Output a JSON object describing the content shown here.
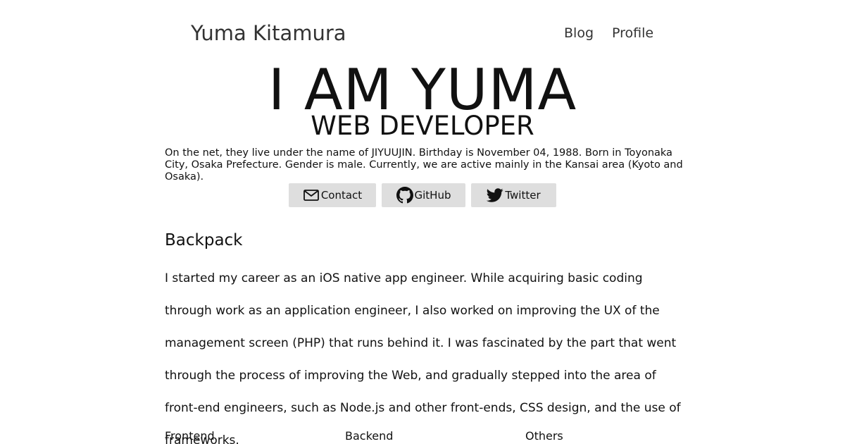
{
  "header": {
    "site_title": "Yuma Kitamura",
    "nav": [
      {
        "label": "Blog"
      },
      {
        "label": "Profile"
      }
    ]
  },
  "hero": {
    "name": "I AM YUMA",
    "role": "WEB DEVELOPER",
    "bio": "On the net, they live under the name of JIYUUJIN. Birthday is November 04, 1988. Born in Toyonaka City, Osaka Prefecture. Gender is male. Currently, we are active mainly in the Kansai area (Kyoto and Osaka)."
  },
  "social": [
    {
      "label": "Contact",
      "icon": "mail-icon"
    },
    {
      "label": "GitHub",
      "icon": "github-icon"
    },
    {
      "label": "Twitter",
      "icon": "twitter-icon"
    }
  ],
  "backpack": {
    "title": "Backpack",
    "body": "I started my career as an iOS native app engineer. While acquiring basic coding through work as an application engineer, I also worked on improving the UX of the management screen (PHP) that runs behind it. I was fascinated by the part that went through the process of improving the Web, and gradually stepped into the area of front-end engineers, such as Node.js and other front-ends, CSS design, and the use of frameworks.",
    "columns": [
      {
        "label": "Frontend"
      },
      {
        "label": "Backend"
      },
      {
        "label": "Others"
      }
    ]
  },
  "colors": {
    "button_bg": "#dedede",
    "text": "#111111",
    "header_text": "#333333"
  }
}
